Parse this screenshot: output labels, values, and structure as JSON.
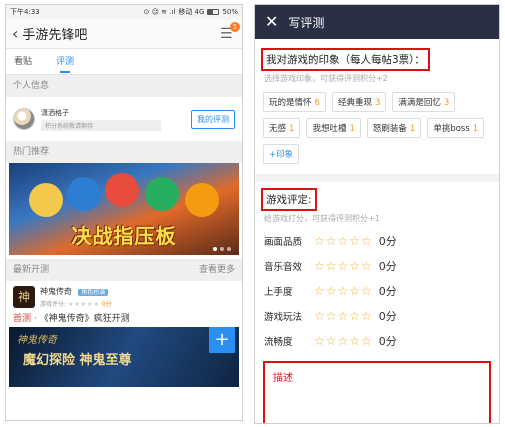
{
  "left": {
    "status": {
      "time": "下午4:33",
      "icons": "⊙ ☺ ≋ .ıl",
      "network": "移动 4G",
      "battery": "50%"
    },
    "nav": {
      "title": "手游先锋吧",
      "badge": "1"
    },
    "tabs": [
      {
        "label": "看贴",
        "active": false
      },
      {
        "label": "评测",
        "active": true
      }
    ],
    "personal": {
      "header": "个人信息",
      "username": "潇洒格子",
      "sub": "积分系统敬请期待",
      "my_review": "我的评测"
    },
    "hot": {
      "header": "热门推荐",
      "banner_title": "决战指压板"
    },
    "latest": {
      "header": "最新开测",
      "more": "查看更多",
      "game_name": "神鬼传奇",
      "game_tag": "角色扮演",
      "score_label": "游戏评分:",
      "stars": "★★★★★",
      "score": "0分",
      "promo_first": "首测",
      "promo_dot": "·",
      "promo_text": "《神鬼传奇》疯狂开测",
      "art_text1": "神鬼传奇",
      "art_text2": "魔幻探险 神鬼至尊"
    }
  },
  "right": {
    "header": {
      "title": "写评测"
    },
    "impression": {
      "title": "我对游戏的印象（每人每帖3票）：",
      "hint": "选择游戏印象，可获得评测积分+2",
      "tags": [
        {
          "label": "玩的是情怀",
          "count": "6"
        },
        {
          "label": "经典重现",
          "count": "3"
        },
        {
          "label": "满满是回忆",
          "count": "3"
        },
        {
          "label": "无感",
          "count": "1"
        },
        {
          "label": "我想吐槽",
          "count": "1"
        },
        {
          "label": "怒刷装备",
          "count": "1"
        },
        {
          "label": "单挑boss",
          "count": "1"
        }
      ],
      "add_label": "+印象"
    },
    "rating": {
      "title": "游戏评定:",
      "hint": "给游戏打分，可获得评测积分+1",
      "stars": "☆☆☆☆☆",
      "items": [
        {
          "label": "画面品质",
          "score": "0分"
        },
        {
          "label": "音乐音效",
          "score": "0分"
        },
        {
          "label": "上手度",
          "score": "0分"
        },
        {
          "label": "游戏玩法",
          "score": "0分"
        },
        {
          "label": "流畅度",
          "score": "0分"
        }
      ]
    },
    "description": {
      "label": "描述"
    }
  }
}
